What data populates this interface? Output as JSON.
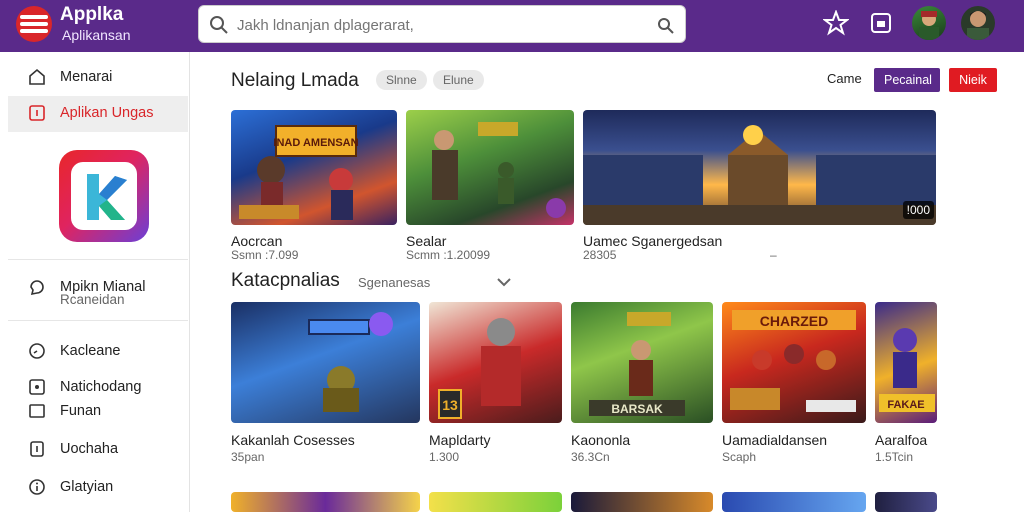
{
  "brand": {
    "title": "Applka",
    "subtitle": "Aplikansan"
  },
  "search": {
    "placeholder": "Jakh ldnanjan dplagerarat,",
    "value": ""
  },
  "colors": {
    "header": "#5a2a8a",
    "accent_red": "#e01b22",
    "active_text": "#d9262a"
  },
  "top_icons": [
    "star-icon",
    "app-window-icon",
    "game-avatar-icon",
    "user-avatar-icon"
  ],
  "sidebar": {
    "items": [
      {
        "label": "Menarai",
        "icon": "home-icon"
      },
      {
        "label": "Aplikan Ungas",
        "icon": "app-box-icon",
        "active": true
      },
      {
        "label": "Mpikn Mianal",
        "sub": "Rcaneidan",
        "icon": "chat-icon"
      },
      {
        "label": "Kacleane",
        "icon": "clock-icon"
      },
      {
        "label": "Natichodang",
        "icon": "image-icon"
      },
      {
        "label": "Funan",
        "icon": "square-icon"
      },
      {
        "label": "Uochaha",
        "icon": "book-icon"
      },
      {
        "label": "Glatyian",
        "icon": "info-icon"
      }
    ]
  },
  "featured": {
    "title": "Nelaing Lmada",
    "chips": [
      "Slnne",
      "Elune"
    ],
    "header_link": "Came",
    "buttons": {
      "primary": "Pecainal",
      "secondary": "Nieik"
    },
    "cards": [
      {
        "title": "Aocrcan",
        "sub": "Ssmn  :7.099",
        "art": "INAD AMENSAN"
      },
      {
        "title": "Sealar",
        "sub": "Scmm  :1.20099",
        "art": ""
      },
      {
        "title": "Uamec Sganergedsan",
        "sub": "28305",
        "extra": "–",
        "badge": "!000"
      }
    ]
  },
  "categories": {
    "title": "Katacpnalias",
    "filter": "Sgenanesas",
    "cards": [
      {
        "title": "Kakanlah Cosesses",
        "sub": "35pan"
      },
      {
        "title": "Mapldarty",
        "sub": "1.300",
        "badge": "13"
      },
      {
        "title": "Kaononla",
        "sub": "36.3Cn",
        "art": "BARSAK"
      },
      {
        "title": "Uamadialdansen",
        "sub": "Scaph",
        "art": "CHARZED"
      },
      {
        "title": "Aaralfoa",
        "sub": "1.5Tcin",
        "art": "FAKAE"
      }
    ]
  }
}
